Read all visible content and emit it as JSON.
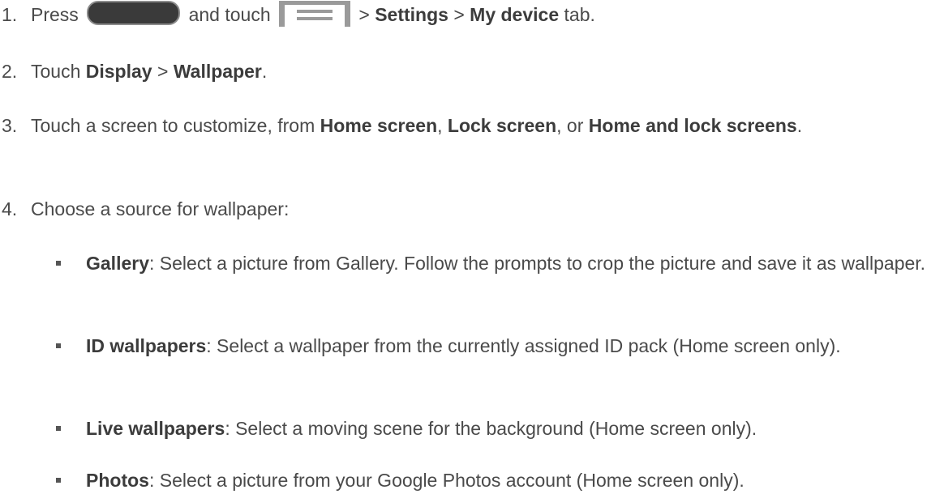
{
  "steps": [
    {
      "num": "1.",
      "press": "Press",
      "and_touch": "and touch",
      "sep1": ">",
      "settings": "Settings",
      "sep2": ">",
      "my_device": "My device",
      "tab": "tab."
    },
    {
      "num": "2.",
      "touch": "Touch",
      "display": "Display",
      "sep": ">",
      "wallpaper": "Wallpaper",
      "end": "."
    },
    {
      "num": "3.",
      "intro": "Touch a screen to customize, from",
      "home_screen": "Home screen",
      "comma1": ",",
      "lock_screen": "Lock screen",
      "or": ", or",
      "home_and_lock": "Home and lock screens",
      "end": "."
    },
    {
      "num": "4.",
      "text": "Choose a source for wallpaper:"
    }
  ],
  "sources": [
    {
      "name": "Gallery",
      "desc": ": Select a picture from Gallery. Follow the prompts to crop the picture and save it as wallpaper."
    },
    {
      "name": "ID wallpapers",
      "desc": ": Select a wallpaper from the currently assigned ID pack (Home screen only)."
    },
    {
      "name": "Live wallpapers",
      "desc": ": Select a moving scene for the background (Home screen only)."
    },
    {
      "name": "Photos",
      "desc": ": Select a picture from your Google Photos account (Home screen only)."
    }
  ],
  "icons": {
    "home_key": "home-key-icon",
    "menu_key": "menu-key-icon"
  }
}
